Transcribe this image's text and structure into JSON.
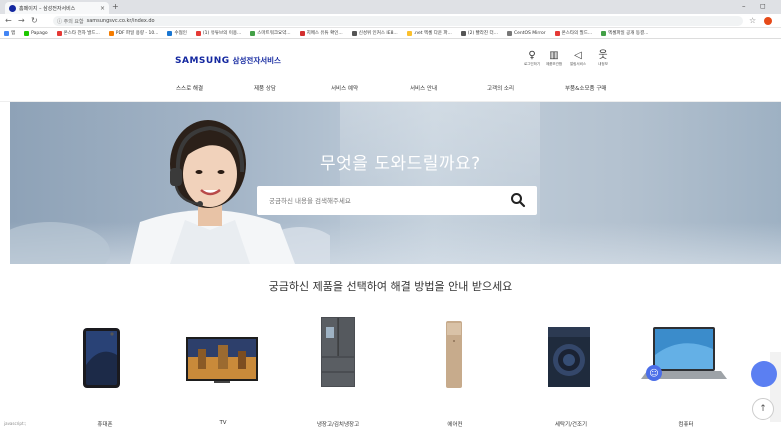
{
  "browser": {
    "tab_title": "홈페이지 – 삼성전자서비스",
    "tab_close": "×",
    "new_tab": "+",
    "window_min": "–",
    "window_max": "◻",
    "url_security_label": "ⓘ 주의 요함",
    "url": "samsungsvc.co.kr/index.do",
    "bookmarks": [
      {
        "label": "앱",
        "color": "#4285f4"
      },
      {
        "label": "Papago",
        "color": "#1ec800"
      },
      {
        "label": "온스타 전자 발드...",
        "color": "#e53935"
      },
      {
        "label": "PDF 파일 용량 - 10...",
        "color": "#f57c00"
      },
      {
        "label": "수협인",
        "color": "#1976d2"
      },
      {
        "label": "(1) 유튜브의 이용...",
        "color": "#e53935"
      },
      {
        "label": "스마트워크요약...",
        "color": "#43a047"
      },
      {
        "label": "지메스 유튜 확인...",
        "color": "#d32f2f"
      },
      {
        "label": "신성위 인커스 IE8...",
        "color": "#555555"
      },
      {
        "label": ".net 엑셀 다운 파...",
        "color": "#fbc02d"
      },
      {
        "label": "(2) 빨라진 더...",
        "color": "#555555"
      },
      {
        "label": "CentOS Mirror",
        "color": "#777777"
      },
      {
        "label": "온스타의 필드...",
        "color": "#e53935"
      },
      {
        "label": "엑셀파일 공개 동결...",
        "color": "#43a047"
      }
    ]
  },
  "site": {
    "logo_mark": "SAMSUNG",
    "logo_sub": "삼성전자서비스",
    "utility": [
      {
        "label": "로그인하기",
        "icon": "user-icon",
        "glyph": "♀"
      },
      {
        "label": "제품보관함",
        "icon": "building-icon",
        "glyph": "▥"
      },
      {
        "label": "알림서비스",
        "icon": "megaphone-icon",
        "glyph": "◁"
      },
      {
        "label": "내정보",
        "icon": "person-icon",
        "glyph": "웃"
      }
    ],
    "nav": [
      "스스로 해결",
      "제품 상담",
      "서비스 예약",
      "서비스 안내",
      "고객의 소리",
      "부품&소모품 구매"
    ]
  },
  "hero": {
    "title": "무엇을 도와드릴까요?",
    "search_placeholder": "궁금하신 내용을 검색해주세요"
  },
  "products": {
    "section_title": "궁금하신 제품을 선택하여 해결 방법을 안내 받으세요",
    "items": [
      {
        "label": "휴대폰",
        "icon": "smartphone-icon"
      },
      {
        "label": "TV",
        "icon": "tv-icon"
      },
      {
        "label": "냉장고/김치냉장고",
        "icon": "refrigerator-icon"
      },
      {
        "label": "에어컨",
        "icon": "air-conditioner-icon"
      },
      {
        "label": "세탁기/건조기",
        "icon": "washer-icon"
      },
      {
        "label": "컴퓨터",
        "icon": "laptop-icon"
      }
    ]
  },
  "floating": {
    "top_button": "↑",
    "status_text": "javascript:;"
  },
  "colors": {
    "brand": "#1428a0",
    "chat": "#5b7ff2"
  }
}
